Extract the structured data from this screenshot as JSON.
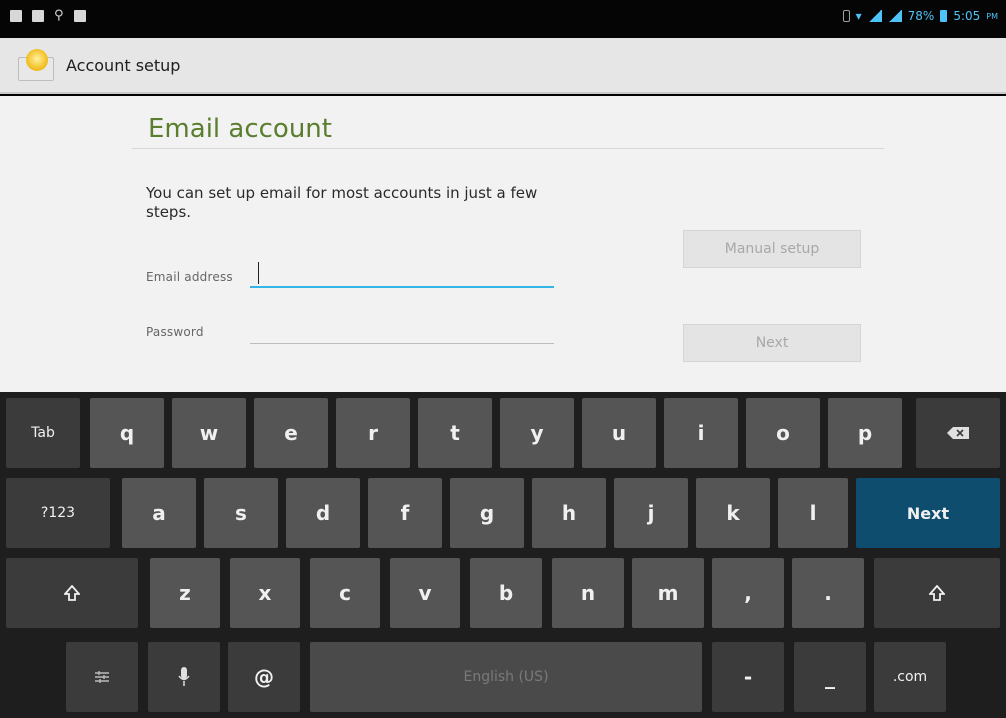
{
  "status_bar": {
    "battery": "78%",
    "time": "5:05",
    "ampm": "PM"
  },
  "action_bar": {
    "title": "Account setup"
  },
  "form": {
    "title": "Email account",
    "intro": "You can set up email for most accounts in just a few steps.",
    "email_label": "Email address",
    "email_value": "",
    "password_label": "Password",
    "password_value": "",
    "manual_setup_label": "Manual setup",
    "next_label": "Next"
  },
  "keyboard": {
    "tab_label": "Tab",
    "row1": [
      "q",
      "w",
      "e",
      "r",
      "t",
      "y",
      "u",
      "i",
      "o",
      "p"
    ],
    "row2": [
      "a",
      "s",
      "d",
      "f",
      "g",
      "h",
      "j",
      "k",
      "l"
    ],
    "row3": [
      "z",
      "x",
      "c",
      "v",
      "b",
      "n",
      "m",
      ",",
      "."
    ],
    "symbols_label": "?123",
    "next_label": "Next",
    "at_label": "@",
    "space_label": "English (US)",
    "dash_label": "-",
    "underscore_label": "_",
    "dotcom_label": ".com",
    "colors": {
      "next_key": "#0e4d6e",
      "key": "#555555",
      "fn_key": "#3b3b3b",
      "accent": "#33b5e5"
    }
  }
}
